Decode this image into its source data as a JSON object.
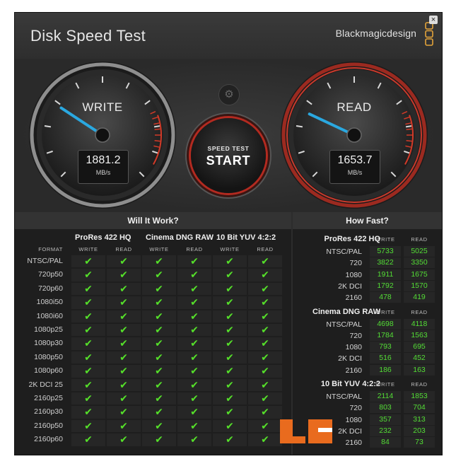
{
  "window": {
    "title": "Disk Speed Test",
    "brand": "Blackmagicdesign",
    "close_label": "×"
  },
  "gauges": {
    "write": {
      "label": "WRITE",
      "value": "1881.2",
      "unit": "MB/s",
      "level": 0.29
    },
    "read": {
      "label": "READ",
      "value": "1653.7",
      "unit": "MB/s",
      "level": 0.26
    }
  },
  "start_button": {
    "small": "SPEED TEST",
    "big": "START"
  },
  "settings_icon": "⚙",
  "will_it_work": {
    "title": "Will It Work?",
    "format_header": "FORMAT",
    "write_header": "WRITE",
    "read_header": "READ",
    "codecs": [
      "ProRes 422 HQ",
      "Cinema DNG RAW",
      "10 Bit YUV 4:2:2"
    ],
    "check": "✔",
    "formats": [
      "NTSC/PAL",
      "720p50",
      "720p60",
      "1080i50",
      "1080i60",
      "1080p25",
      "1080p30",
      "1080p50",
      "1080p60",
      "2K DCI 25",
      "2160p25",
      "2160p30",
      "2160p50",
      "2160p60"
    ]
  },
  "how_fast": {
    "title": "How Fast?",
    "write_header": "WRITE",
    "read_header": "READ",
    "groups": [
      {
        "name": "ProRes 422 HQ",
        "rows": [
          {
            "format": "NTSC/PAL",
            "write": "5733",
            "read": "5025"
          },
          {
            "format": "720",
            "write": "3822",
            "read": "3350"
          },
          {
            "format": "1080",
            "write": "1911",
            "read": "1675"
          },
          {
            "format": "2K DCI",
            "write": "1792",
            "read": "1570"
          },
          {
            "format": "2160",
            "write": "478",
            "read": "419"
          }
        ]
      },
      {
        "name": "Cinema DNG RAW",
        "rows": [
          {
            "format": "NTSC/PAL",
            "write": "4698",
            "read": "4118"
          },
          {
            "format": "720",
            "write": "1784",
            "read": "1563"
          },
          {
            "format": "1080",
            "write": "793",
            "read": "695"
          },
          {
            "format": "2K DCI",
            "write": "516",
            "read": "452"
          },
          {
            "format": "2160",
            "write": "186",
            "read": "163"
          }
        ]
      },
      {
        "name": "10 Bit YUV 4:2:2",
        "rows": [
          {
            "format": "NTSC/PAL",
            "write": "2114",
            "read": "1853"
          },
          {
            "format": "720",
            "write": "803",
            "read": "704"
          },
          {
            "format": "1080",
            "write": "357",
            "read": "313"
          },
          {
            "format": "2K DCI",
            "write": "232",
            "read": "203"
          },
          {
            "format": "2160",
            "write": "84",
            "read": "73"
          }
        ]
      }
    ]
  },
  "colors": {
    "needle": "#2aa8e0",
    "check": "#55e02a",
    "accent_red": "#c0392b",
    "brand_logo": "#e3a33a"
  }
}
